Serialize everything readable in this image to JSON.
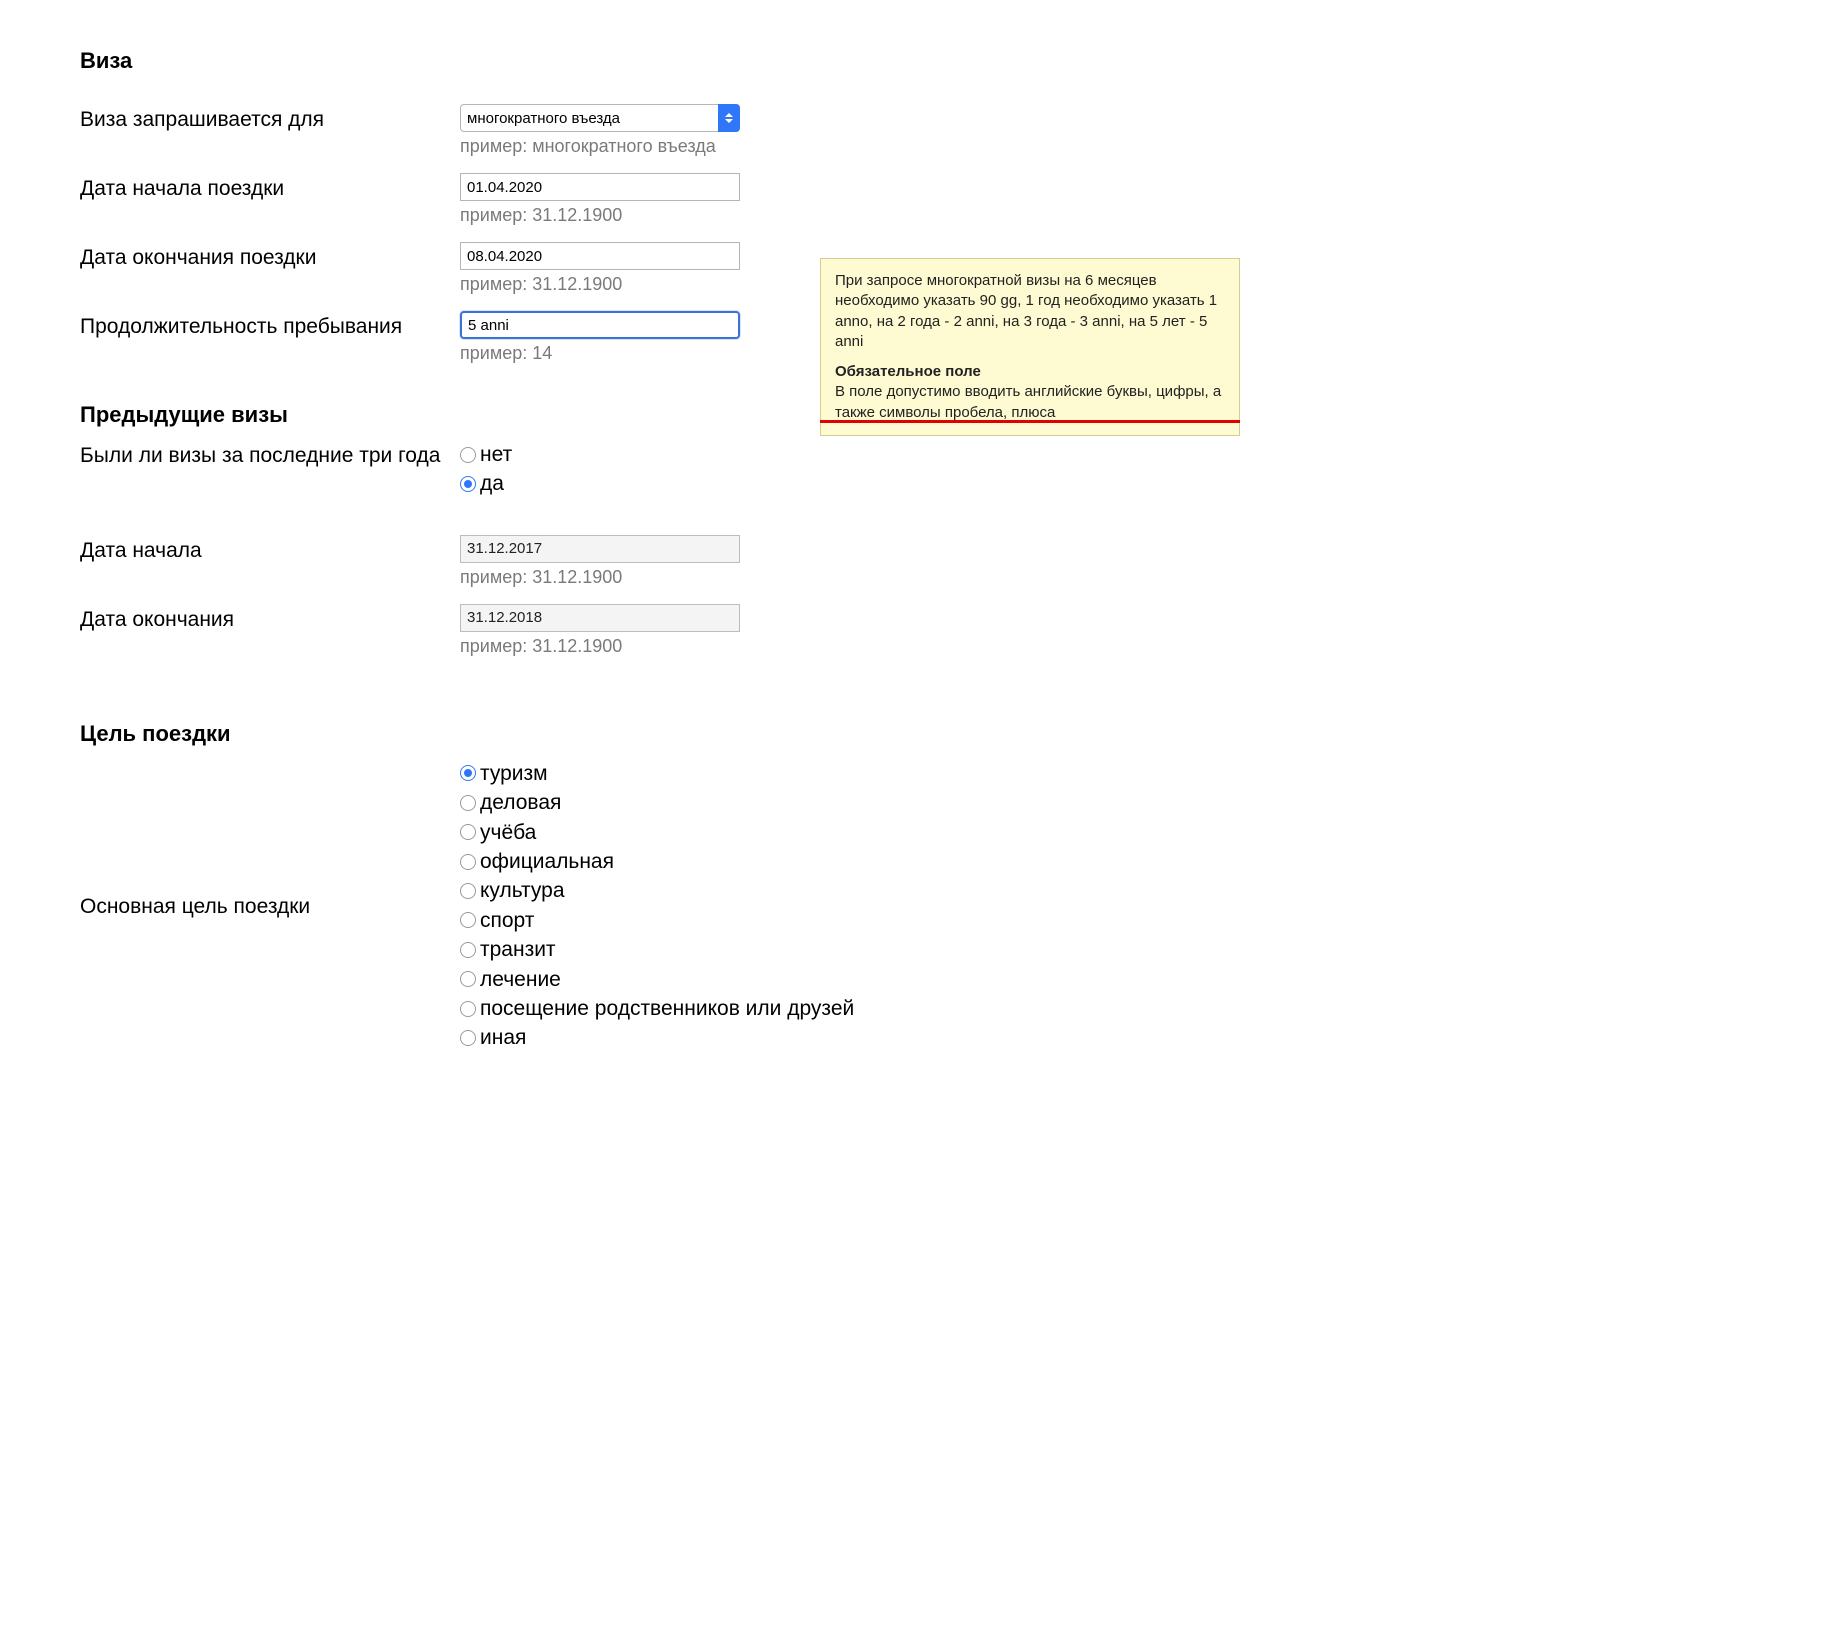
{
  "sections": {
    "visa": {
      "title": "Виза",
      "visa_requested_for": {
        "label": "Виза запрашивается для",
        "value": "многократного въезда",
        "example": "пример: многократного въезда"
      },
      "start_date": {
        "label": "Дата начала поездки",
        "value": "01.04.2020",
        "example": "пример: 31.12.1900"
      },
      "end_date": {
        "label": "Дата окончания поездки",
        "value": "08.04.2020",
        "example": "пример: 31.12.1900"
      },
      "duration": {
        "label": "Продолжительность пребывания",
        "value": "5 anni",
        "example": "пример: 14"
      }
    },
    "previous_visas": {
      "title": "Предыдущие визы",
      "had_visas": {
        "label": "Были ли визы за последние три года",
        "options": {
          "no": "нет",
          "yes": "да"
        },
        "selected": "yes"
      },
      "prev_start": {
        "label": "Дата начала",
        "value": "31.12.2017",
        "example": "пример: 31.12.1900"
      },
      "prev_end": {
        "label": "Дата окончания",
        "value": "31.12.2018",
        "example": "пример: 31.12.1900"
      }
    },
    "trip_purpose": {
      "title": "Цель поездки",
      "purpose": {
        "label": "Основная цель поездки",
        "options": [
          "туризм",
          "деловая",
          "учёба",
          "официальная",
          "культура",
          "спорт",
          "транзит",
          "лечение",
          "посещение родственников или друзей",
          "иная"
        ],
        "selected_index": 0
      }
    }
  },
  "tooltip": {
    "para1": "При запросе многократной визы на 6 месяцев необходимо указать 90 gg, 1 год необходимо указать 1 anno, на 2 года - 2 anni, на 3 года - 3 anni, на 5 лет - 5 anni",
    "strong": "Обязательное поле",
    "para2": "В поле допустимо вводить английские буквы, цифры, а также символы пробела, плюса"
  }
}
